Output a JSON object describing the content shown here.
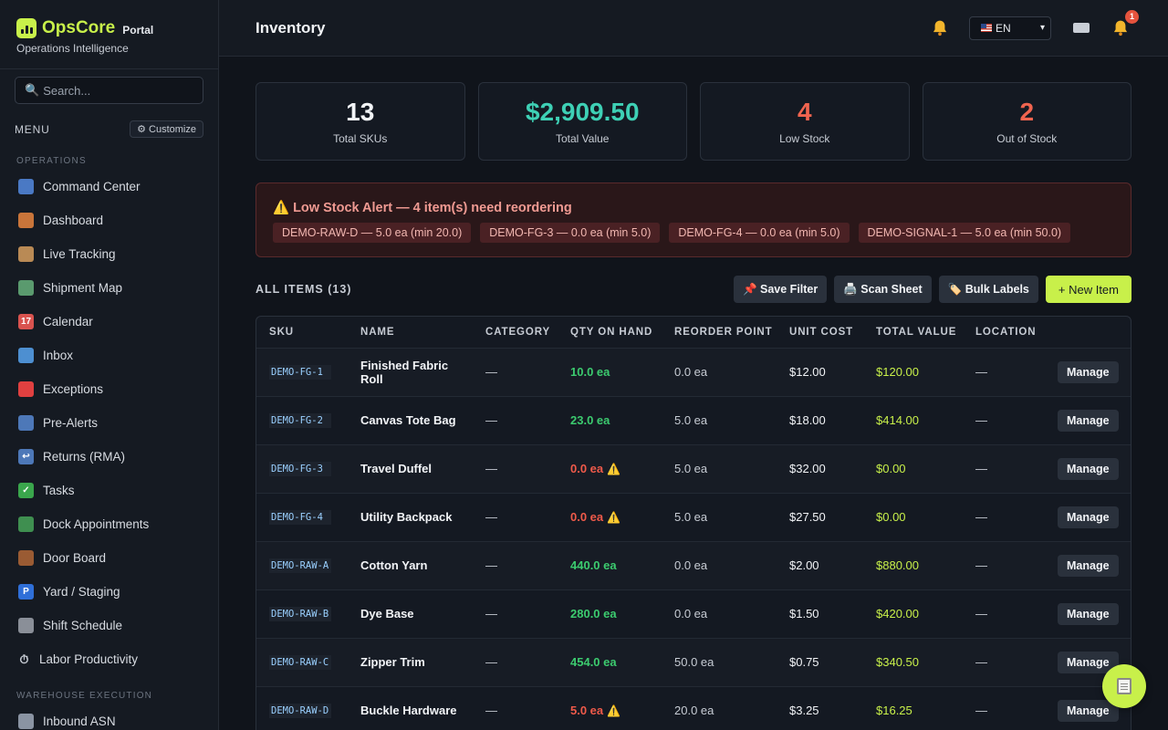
{
  "brand": {
    "name": "OpsCore",
    "suffix": "Portal",
    "tagline": "Operations Intelligence",
    "accent": "#c8f04a"
  },
  "search": {
    "placeholder": "Search..."
  },
  "menu": {
    "label": "MENU",
    "customize": "⚙ Customize"
  },
  "sections": {
    "operations": "OPERATIONS",
    "warehouse": "WAREHOUSE EXECUTION"
  },
  "nav_operations": [
    {
      "label": "Command Center",
      "icon": "command-center-icon",
      "glyph": "",
      "color": "#4a79c4"
    },
    {
      "label": "Dashboard",
      "icon": "house-icon",
      "glyph": "",
      "color": "#c9753a"
    },
    {
      "label": "Live Tracking",
      "icon": "package-icon",
      "glyph": "",
      "color": "#b98a55"
    },
    {
      "label": "Shipment Map",
      "icon": "map-icon",
      "glyph": "",
      "color": "#5a9a6e"
    },
    {
      "label": "Calendar",
      "icon": "calendar-icon",
      "glyph": "17",
      "color": "#d9534f"
    },
    {
      "label": "Inbox",
      "icon": "inbox-tray-icon",
      "glyph": "",
      "color": "#4d8fd1"
    },
    {
      "label": "Exceptions",
      "icon": "siren-icon",
      "glyph": "",
      "color": "#e04040"
    },
    {
      "label": "Pre-Alerts",
      "icon": "mailbox-icon",
      "glyph": "",
      "color": "#4d78b8"
    },
    {
      "label": "Returns (RMA)",
      "icon": "return-arrow-icon",
      "glyph": "↩",
      "color": "#4d78b8"
    },
    {
      "label": "Tasks",
      "icon": "check-mark-icon",
      "glyph": "✓",
      "color": "#3aa64c"
    },
    {
      "label": "Dock Appointments",
      "icon": "truck-icon",
      "glyph": "",
      "color": "#3f8f50"
    },
    {
      "label": "Door Board",
      "icon": "door-icon",
      "glyph": "",
      "color": "#9a5b33"
    },
    {
      "label": "Yard / Staging",
      "icon": "parking-icon",
      "glyph": "P",
      "color": "#2f6fd8"
    },
    {
      "label": "Shift Schedule",
      "icon": "spiral-calendar-icon",
      "glyph": "",
      "color": "#8a8f98"
    },
    {
      "label": "Labor Productivity",
      "icon": "stopwatch-icon",
      "glyph": "⏱",
      "color": "transparent"
    }
  ],
  "nav_warehouse": [
    {
      "label": "Inbound ASN",
      "icon": "incoming-envelope-icon",
      "glyph": "",
      "color": "#8a94a3"
    }
  ],
  "header": {
    "title": "Inventory",
    "language": "EN",
    "notification_count": "1"
  },
  "stats": [
    {
      "value": "13",
      "label": "Total SKUs",
      "color": "#f2f4f7"
    },
    {
      "value": "$2,909.50",
      "label": "Total Value",
      "color": "#3ed0b5"
    },
    {
      "value": "4",
      "label": "Low Stock",
      "color": "#f0644f"
    },
    {
      "value": "2",
      "label": "Out of Stock",
      "color": "#f0644f"
    }
  ],
  "alert": {
    "icon": "⚠️",
    "title": "Low Stock Alert — 4 item(s) need reordering",
    "chips": [
      "DEMO-RAW-D — 5.0 ea (min 20.0)",
      "DEMO-FG-3 — 0.0 ea (min 5.0)",
      "DEMO-FG-4 — 0.0 ea (min 5.0)",
      "DEMO-SIGNAL-1 — 5.0 ea (min 50.0)"
    ]
  },
  "toolbar": {
    "all_items": "ALL ITEMS (13)",
    "save_filter": "📌 Save Filter",
    "scan_sheet": "🖨️ Scan Sheet",
    "bulk_labels": "🏷️ Bulk Labels",
    "new_item": "+ New Item"
  },
  "table": {
    "columns": [
      "SKU",
      "NAME",
      "CATEGORY",
      "QTY ON HAND",
      "REORDER POINT",
      "UNIT COST",
      "TOTAL VALUE",
      "LOCATION",
      ""
    ],
    "manage_label": "Manage",
    "rows": [
      {
        "sku": "DEMO-FG-1",
        "name": "Finished Fabric Roll",
        "category": "—",
        "qty": "10.0 ea",
        "low": false,
        "reorder": "0.0 ea",
        "unit_cost": "$12.00",
        "total": "$120.00",
        "location": "—"
      },
      {
        "sku": "DEMO-FG-2",
        "name": "Canvas Tote Bag",
        "category": "—",
        "qty": "23.0 ea",
        "low": false,
        "reorder": "5.0 ea",
        "unit_cost": "$18.00",
        "total": "$414.00",
        "location": "—"
      },
      {
        "sku": "DEMO-FG-3",
        "name": "Travel Duffel",
        "category": "—",
        "qty": "0.0 ea",
        "low": true,
        "reorder": "5.0 ea",
        "unit_cost": "$32.00",
        "total": "$0.00",
        "location": "—"
      },
      {
        "sku": "DEMO-FG-4",
        "name": "Utility Backpack",
        "category": "—",
        "qty": "0.0 ea",
        "low": true,
        "reorder": "5.0 ea",
        "unit_cost": "$27.50",
        "total": "$0.00",
        "location": "—"
      },
      {
        "sku": "DEMO-RAW-A",
        "name": "Cotton Yarn",
        "category": "—",
        "qty": "440.0 ea",
        "low": false,
        "reorder": "0.0 ea",
        "unit_cost": "$2.00",
        "total": "$880.00",
        "location": "—"
      },
      {
        "sku": "DEMO-RAW-B",
        "name": "Dye Base",
        "category": "—",
        "qty": "280.0 ea",
        "low": false,
        "reorder": "0.0 ea",
        "unit_cost": "$1.50",
        "total": "$420.00",
        "location": "—"
      },
      {
        "sku": "DEMO-RAW-C",
        "name": "Zipper Trim",
        "category": "—",
        "qty": "454.0 ea",
        "low": false,
        "reorder": "50.0 ea",
        "unit_cost": "$0.75",
        "total": "$340.50",
        "location": "—"
      },
      {
        "sku": "DEMO-RAW-D",
        "name": "Buckle Hardware",
        "category": "—",
        "qty": "5.0 ea",
        "low": true,
        "reorder": "20.0 ea",
        "unit_cost": "$3.25",
        "total": "$16.25",
        "location": "—"
      }
    ]
  }
}
